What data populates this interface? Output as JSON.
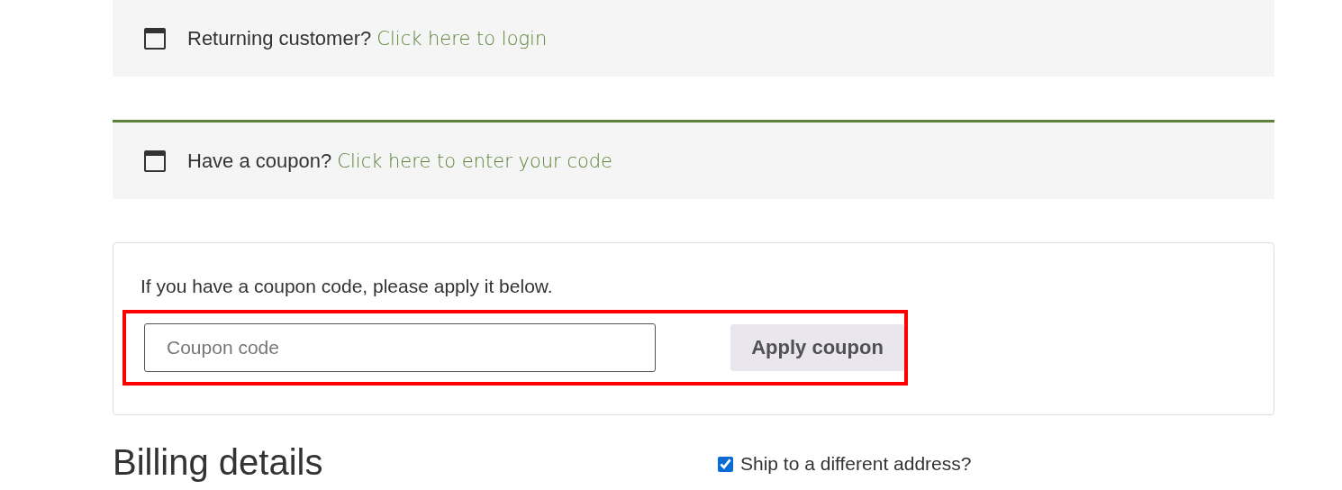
{
  "notices": [
    {
      "text": "Returning customer?",
      "link": "Click here to login",
      "accent": false
    },
    {
      "text": "Have a coupon?",
      "link": "Click here to enter your code",
      "accent": true
    }
  ],
  "coupon_form": {
    "intro": "If you have a coupon code, please apply it below.",
    "placeholder": "Coupon code",
    "button": "Apply coupon",
    "highlighted": true
  },
  "billing": {
    "heading": "Billing details",
    "ship_option": {
      "label": "Ship to a different address?",
      "checked": true
    }
  }
}
